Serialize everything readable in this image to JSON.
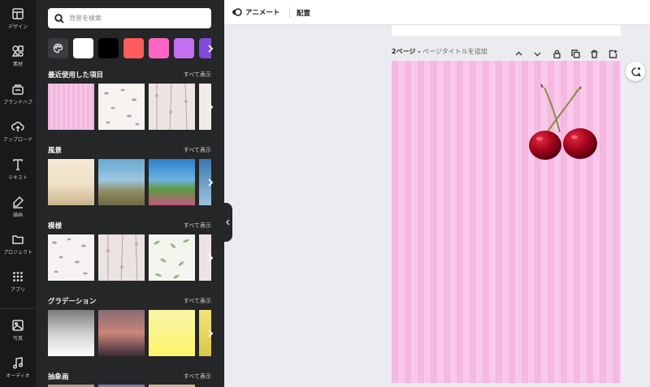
{
  "rail": {
    "items": [
      {
        "label": "デザイン",
        "icon": "layout-icon"
      },
      {
        "label": "素材",
        "icon": "elements-icon"
      },
      {
        "label": "ブランドハブ",
        "icon": "brand-icon"
      },
      {
        "label": "アップロード",
        "icon": "upload-icon"
      },
      {
        "label": "テキスト",
        "icon": "text-icon"
      },
      {
        "label": "描画",
        "icon": "draw-icon"
      },
      {
        "label": "プロジェクト",
        "icon": "folder-icon"
      },
      {
        "label": "アプリ",
        "icon": "apps-icon"
      },
      {
        "label": "写真",
        "icon": "photo-icon"
      },
      {
        "label": "オーディオ",
        "icon": "audio-icon"
      }
    ]
  },
  "panel": {
    "search_placeholder": "背景を検索",
    "colors": [
      "#ffffff",
      "#000000",
      "#ff5c5c",
      "#ff66c4",
      "#c46ef0",
      "#7d4cdb"
    ],
    "sections": [
      {
        "title": "最近使用した項目",
        "more": "すべて表示"
      },
      {
        "title": "風景",
        "more": "すべて表示"
      },
      {
        "title": "模様",
        "more": "すべて表示"
      },
      {
        "title": "グラデーション",
        "more": "すべて表示"
      },
      {
        "title": "抽象画",
        "more": "すべて表示"
      }
    ]
  },
  "toolbar": {
    "animate_label": "アニメート",
    "position_label": "配置"
  },
  "page": {
    "number_label": "2ページ -",
    "title_placeholder": "ページタイトルを追加"
  }
}
